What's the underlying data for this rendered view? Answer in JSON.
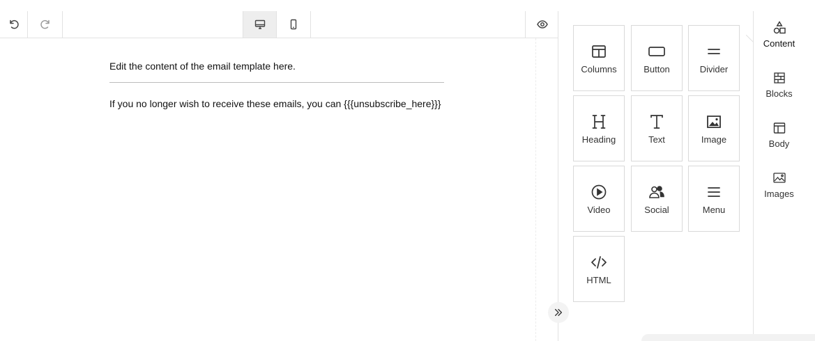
{
  "toolbar": {
    "undo_icon": "undo-icon",
    "redo_icon": "redo-icon",
    "desktop_icon": "desktop-icon",
    "mobile_icon": "mobile-icon",
    "preview_icon": "eye-icon"
  },
  "email": {
    "intro_text": "Edit the content of the email template here.",
    "footer_text": "If you no longer wish to receive these emails, you can {{{unsubscribe_here}}}"
  },
  "content_tools": [
    {
      "label": "Columns",
      "icon": "columns-icon"
    },
    {
      "label": "Button",
      "icon": "button-icon"
    },
    {
      "label": "Divider",
      "icon": "divider-icon"
    },
    {
      "label": "Heading",
      "icon": "heading-icon"
    },
    {
      "label": "Text",
      "icon": "text-icon"
    },
    {
      "label": "Image",
      "icon": "image-icon"
    },
    {
      "label": "Video",
      "icon": "video-icon"
    },
    {
      "label": "Social",
      "icon": "social-icon"
    },
    {
      "label": "Menu",
      "icon": "menu-icon"
    },
    {
      "label": "HTML",
      "icon": "code-icon"
    }
  ],
  "tabs": [
    {
      "label": "Content",
      "icon": "shapes-icon",
      "active": true
    },
    {
      "label": "Blocks",
      "icon": "blocks-icon"
    },
    {
      "label": "Body",
      "icon": "body-layout-icon"
    },
    {
      "label": "Images",
      "icon": "images-icon"
    }
  ],
  "colors": {
    "border": "#d9d9d9",
    "active_toggle": "#eeeeee",
    "text": "#333333"
  }
}
